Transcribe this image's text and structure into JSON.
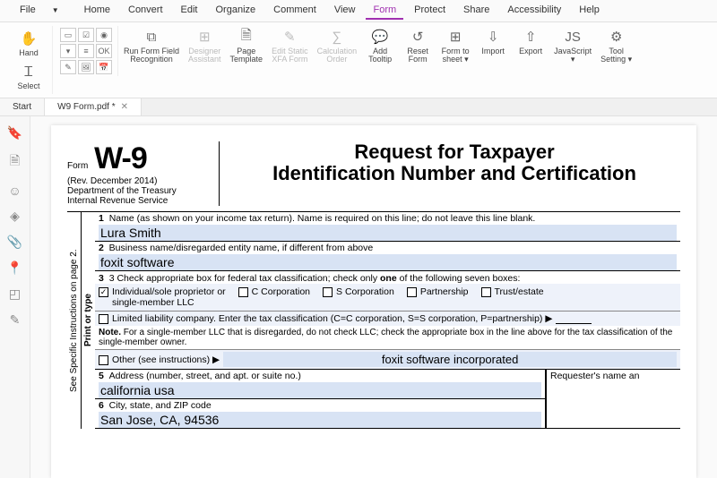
{
  "menu": {
    "file": "File",
    "home": "Home",
    "convert": "Convert",
    "edit": "Edit",
    "organize": "Organize",
    "comment": "Comment",
    "view": "View",
    "form": "Form",
    "protect": "Protect",
    "share": "Share",
    "accessibility": "Accessibility",
    "help": "Help"
  },
  "ribbon": {
    "hand": "Hand",
    "select": "Select",
    "run_form": "Run Form Field\nRecognition",
    "designer": "Designer\nAssistant",
    "page_template": "Page\nTemplate",
    "edit_static": "Edit Static\nXFA Form",
    "calc_order": "Calculation\nOrder",
    "add_tooltip": "Add\nTooltip",
    "reset_form": "Reset\nForm",
    "form_to_sheet": "Form to\nsheet ▾",
    "import": "Import",
    "export": "Export",
    "javascript": "JavaScript\n▾",
    "tool_setting": "Tool\nSetting ▾"
  },
  "tabs": {
    "start": "Start",
    "doc": "W9 Form.pdf *"
  },
  "form": {
    "form_label": "Form",
    "w9": "W-9",
    "rev": "(Rev. December 2014)",
    "dept": "Department of the Treasury\nInternal Revenue Service",
    "title": "Request for Taxpayer\nIdentification Number and Certification",
    "vlabel_print": "Print or type",
    "vlabel_see": "See Specific Instructions on page 2.",
    "line1_hdr": "1  Name (as shown on your income tax return). Name is required on this line; do not leave this line blank.",
    "line1_val": "Lura Smith",
    "line2_hdr": "2  Business name/disregarded entity name, if different from above",
    "line2_val": "foxit software",
    "line3_hdr_a": "3  Check appropriate box for federal tax classification; check only ",
    "line3_hdr_b": "one",
    "line3_hdr_c": " of the following seven boxes:",
    "cb_individual": "Individual/sole proprietor or\nsingle-member LLC",
    "cb_ccorp": "C Corporation",
    "cb_scorp": "S Corporation",
    "cb_partnership": "Partnership",
    "cb_trust": "Trust/estate",
    "llc_line": "Limited liability company. Enter the tax classification (C=C corporation, S=S corporation, P=partnership) ▶",
    "note": "Note. For a single-member LLC that is disregarded, do not check LLC; check the appropriate box in the line above for the tax classification of the single-member owner.",
    "cb_other": "Other (see instructions) ▶",
    "other_val": "foxit software incorporated",
    "line5_hdr": "5  Address (number, street, and apt. or suite no.)",
    "line5_val": "california usa",
    "requester": "Requester's name an",
    "line6_hdr": "6  City, state, and ZIP code",
    "line6_val": "San Jose, CA, 94536"
  }
}
